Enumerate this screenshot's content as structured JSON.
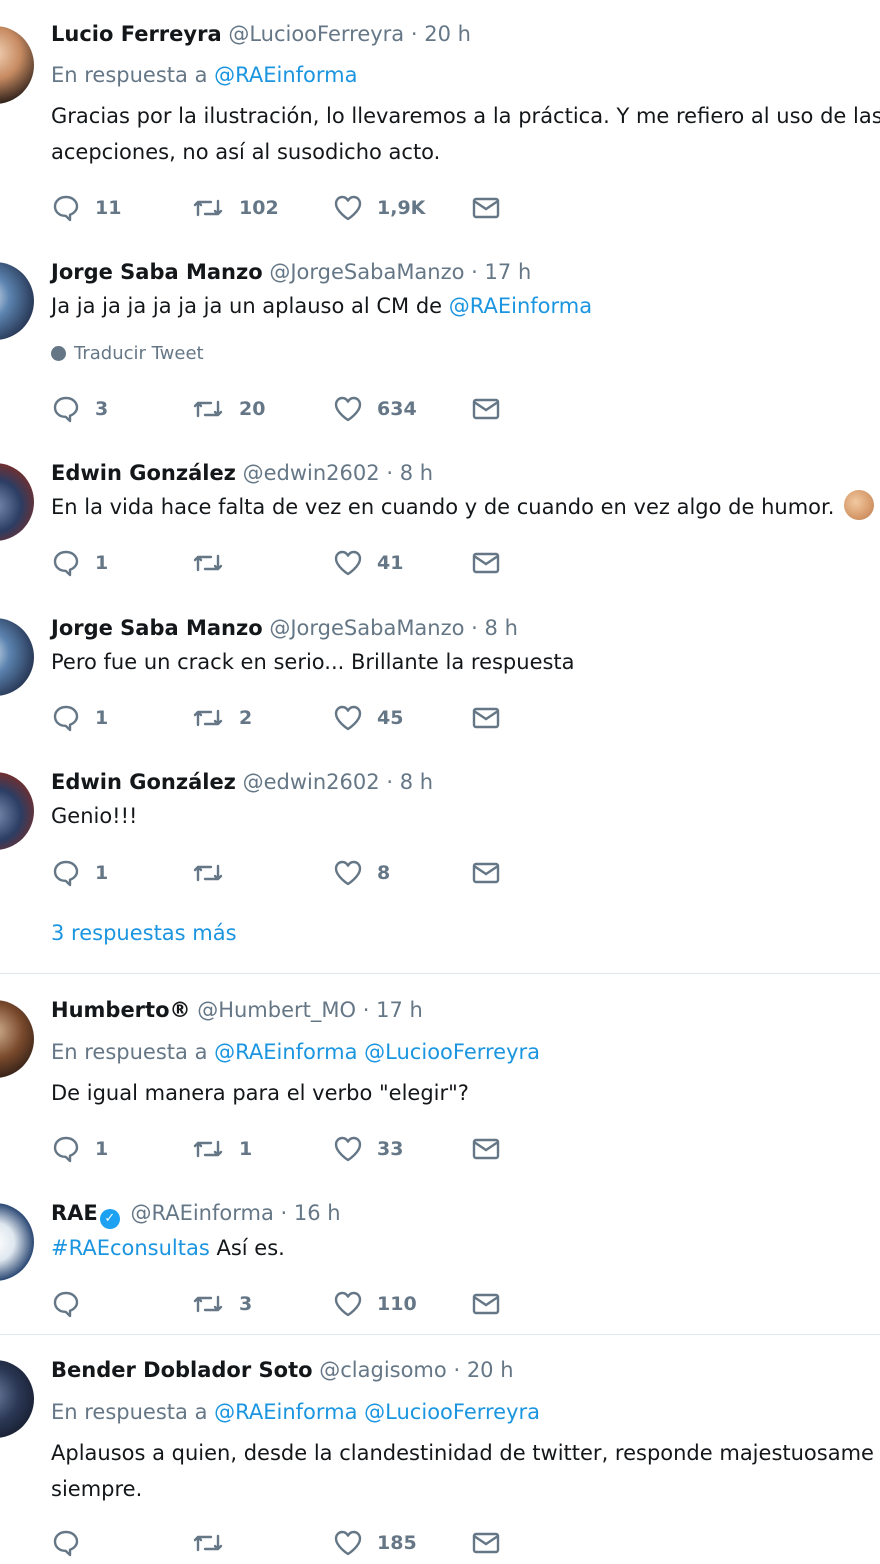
{
  "tweets": [
    {
      "name": "Lucio Ferreyra",
      "handle": "@LuciooFerreyra",
      "time": "20 h",
      "reply_prefix": "En respuesta a",
      "reply_to": "@RAEinforma",
      "text_lines": [
        "Gracias por la ilustración, lo llevaremos a la práctica. Y me refiero al uso de las",
        "acepciones, no así al susodicho acto."
      ],
      "replies": "11",
      "retweets": "102",
      "likes": "1,9K"
    },
    {
      "name": "Jorge Saba Manzo",
      "handle": "@JorgeSabaManzo",
      "time": "17 h",
      "text": "Ja ja ja ja ja ja ja un aplauso al CM de ",
      "text_mention": "@RAEinforma",
      "translate": "Traducir Tweet",
      "replies": "3",
      "retweets": "20",
      "likes": "634"
    },
    {
      "name": "Edwin González",
      "handle": "@edwin2602",
      "time": "8 h",
      "text": "En la vida hace falta de vez en cuando y de cuando en vez algo de humor.",
      "replies": "1",
      "retweets": "",
      "likes": "41"
    },
    {
      "name": "Jorge Saba Manzo",
      "handle": "@JorgeSabaManzo",
      "time": "8 h",
      "text": "Pero fue un crack en serio... Brillante la respuesta",
      "replies": "1",
      "retweets": "2",
      "likes": "45"
    },
    {
      "name": "Edwin González",
      "handle": "@edwin2602",
      "time": "8 h",
      "text": "Genio!!!",
      "replies": "1",
      "retweets": "",
      "likes": "8"
    },
    {
      "name": "Humberto®",
      "handle": "@Humbert_MO",
      "time": "17 h",
      "reply_prefix": "En respuesta a",
      "reply_to": "@RAEinforma",
      "reply_to_2": "@LuciooFerreyra",
      "text": "De igual manera para el verbo \"elegir\"?",
      "replies": "1",
      "retweets": "1",
      "likes": "33"
    },
    {
      "name": "RAE",
      "handle": "@RAEinforma",
      "time": "16 h",
      "hashtag": "#RAEconsultas",
      "text": " Así es.",
      "replies": "",
      "retweets": "3",
      "likes": "110"
    },
    {
      "name": "Bender Doblador Soto",
      "handle": "@clagisomo",
      "time": "20 h",
      "reply_prefix": "En respuesta a",
      "reply_to": "@RAEinforma",
      "reply_to_2": "@LuciooFerreyra",
      "text_lines": [
        "Aplausos a quien, desde la clandestinidad de twitter, responde majestuosame",
        "siempre."
      ],
      "replies": "",
      "retweets": "",
      "likes": "185"
    }
  ],
  "more_replies": "3 respuestas más",
  "dot": "·",
  "colors": {
    "accent": "#1b95e0",
    "muted": "#657786",
    "text": "#14171a",
    "verified": "#1da1f2"
  },
  "icons": [
    "reply-icon",
    "retweet-icon",
    "like-icon",
    "dm-icon",
    "verified-icon",
    "globe-icon",
    "clap-emoji"
  ]
}
